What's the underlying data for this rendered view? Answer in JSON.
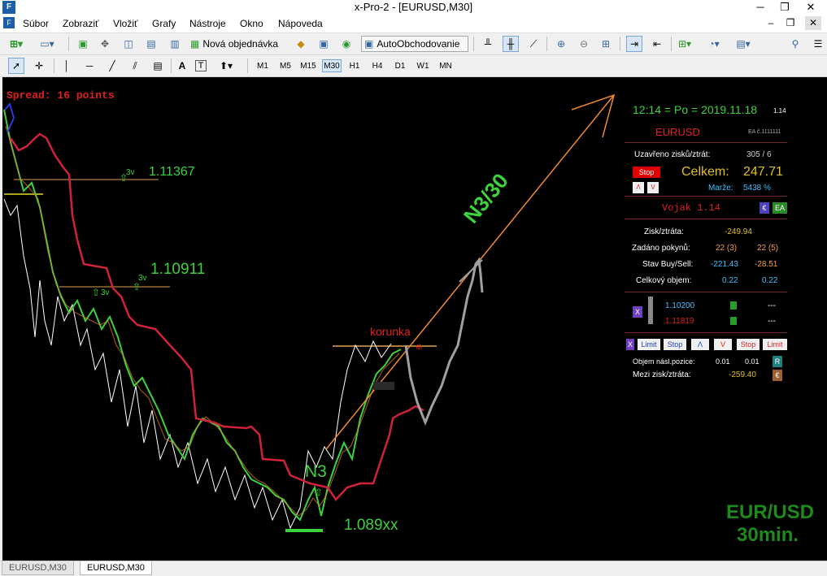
{
  "window": {
    "title": "x-Pro-2 - [EURUSD,M30]",
    "minimize": "─",
    "restore": "❐",
    "close": "✕"
  },
  "menu": {
    "items": [
      "Súbor",
      "Zobraziť",
      "Vložiť",
      "Grafy",
      "Nástroje",
      "Okno",
      "Nápoveda"
    ]
  },
  "toolbar": {
    "new_order": "Nová objednávka",
    "autotrading": "AutoObchodovanie",
    "text_tool": "A",
    "label_tool": "T"
  },
  "timeframes": [
    "M1",
    "M5",
    "M15",
    "M30",
    "H1",
    "H4",
    "D1",
    "W1",
    "MN"
  ],
  "active_timeframe": "M30",
  "chart": {
    "spread": "Spread: 16 points",
    "level_top": "1.11367",
    "level_mid": "1.10911",
    "level_low": "1.089xx",
    "tag_3v": "3v",
    "pattern_label": "N3",
    "arrow_label": "N3/30",
    "korunka": "korunka",
    "symbol_title": "EUR/USD",
    "timeframe_title": "30min.",
    "colors": {
      "background": "#000000",
      "envelope": "#d0223a",
      "projection": "#f08a30",
      "path": "#a0a0a0",
      "label_green": "#3ed13e"
    }
  },
  "panel": {
    "time": "12:14 = Po = 2019.11.18",
    "version_small": "1.14",
    "symbol": "EURUSD",
    "ea_small": "EA č.1111111",
    "closed_pl_label": "Uzavřeno zisků/ztrát:",
    "closed_pl_value": "305 / 6",
    "stop_btn": "Stop",
    "total_label": "Celkem:",
    "total_value": "247.71",
    "small_a": "Λ",
    "small_v": "V",
    "margin_label": "Marže:",
    "margin_value": "5438 %",
    "vojak": "Vojak  1.14",
    "euro_btn": "€",
    "ea_btn": "EA",
    "pl_label": "Zisk/ztráta:",
    "pl_value": "-249.94",
    "orders_label": "Zadáno pokynů:",
    "orders_buy": "22 (3)",
    "orders_sell": "22 (5)",
    "state_label": "Stav Buy/Sell:",
    "state_buy": "-221.43",
    "state_sell": "-28.51",
    "volume_label": "Celkový objem:",
    "volume_buy": "0.22",
    "volume_sell": "0.22",
    "x_btn": "X",
    "price_buy": "1.10200",
    "price_sell": "1.11819",
    "dashes_1": "---",
    "dashes_2": "---",
    "btn_x2": "X",
    "btn_limit1": "Limit",
    "btn_stop1": "Stop",
    "btn_lambda": "Λ",
    "btn_v": "V",
    "btn_stop2": "Stop",
    "btn_limit2": "Limit",
    "next_volume_label": "Objem násl.pozice:",
    "next_volume_buy": "0.01",
    "next_volume_sell": "0.01",
    "r_btn": "R",
    "between_label": "Mezi zisk/ztráta:",
    "between_value": "-259.40",
    "e_btn": "€"
  },
  "tabs": [
    "EURUSD,M30",
    "EURUSD,M30"
  ],
  "active_tab": 1
}
